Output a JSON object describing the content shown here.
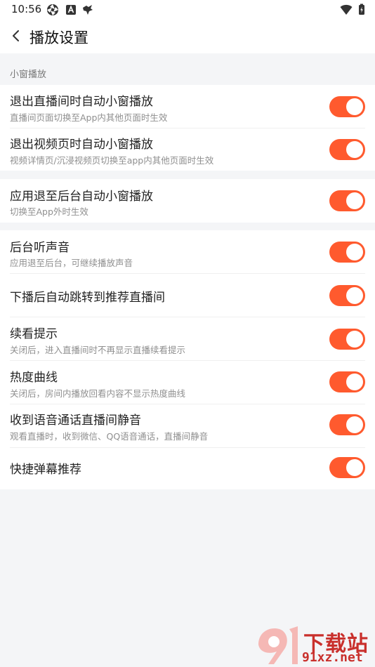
{
  "status_bar": {
    "time": "10:56",
    "icons_left": [
      "aperture-icon",
      "a-badge-icon",
      "bird-icon"
    ],
    "icons_right": [
      "wifi-icon",
      "battery-charging-icon"
    ]
  },
  "header": {
    "title": "播放设置",
    "back_icon": "chevron-left-icon"
  },
  "section_mini_window": {
    "label": "小窗播放"
  },
  "group1": {
    "rows": [
      {
        "title": "退出直播间时自动小窗播放",
        "desc": "直播间页面切换至App内其他页面时生效",
        "enabled": true
      },
      {
        "title": "退出视频页时自动小窗播放",
        "desc": "视频详情页/沉浸视频页切换至app内其他页面时生效",
        "enabled": true
      }
    ]
  },
  "group2": {
    "rows": [
      {
        "title": "应用退至后台自动小窗播放",
        "desc": "切换至App外时生效",
        "enabled": true
      }
    ]
  },
  "group3": {
    "rows": [
      {
        "title": "后台听声音",
        "desc": "应用退至后台，可继续播放声音",
        "enabled": true
      },
      {
        "title": "下播后自动跳转到推荐直播间",
        "enabled": true
      },
      {
        "title": "续看提示",
        "desc": "关闭后，进入直播间时不再显示直播续看提示",
        "enabled": true
      },
      {
        "title": "热度曲线",
        "desc": "关闭后，房间内播放回看内容不显示热度曲线",
        "enabled": true
      },
      {
        "title": "收到语音通话直播间静音",
        "desc": "观看直播时，收到微信、QQ语音通话，直播间静音",
        "enabled": true
      },
      {
        "title": "快捷弹幕推荐",
        "enabled": true
      }
    ]
  },
  "watermark": {
    "top": "下载站",
    "bottom": "91xz.net"
  },
  "colors": {
    "accent": "#ff5a2e",
    "background": "#f4f5f7",
    "card": "#ffffff"
  }
}
